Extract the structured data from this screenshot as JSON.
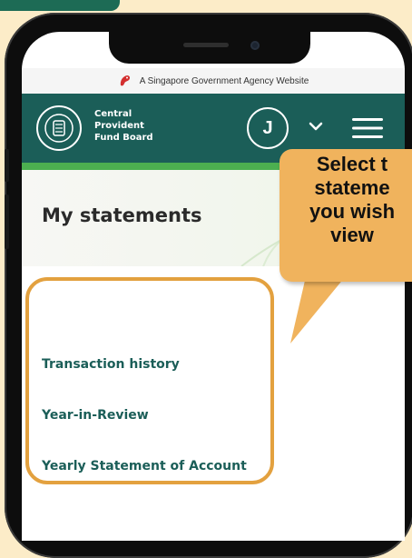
{
  "gov_banner": {
    "text": "A Singapore Government Agency Website"
  },
  "header": {
    "logo_lines": [
      "Central",
      "Provident",
      "Fund Board"
    ],
    "avatar_initial": "J",
    "icons": {
      "chevron": "chevron-down-icon",
      "menu": "hamburger-menu-icon",
      "logo": "cpf-emblem-icon",
      "gov": "merlion-icon"
    }
  },
  "page": {
    "title": "My statements",
    "links": [
      "Transaction history",
      "Year-in-Review",
      "Yearly Statement of Account"
    ]
  },
  "callout": {
    "lines": [
      "Select t",
      "stateme",
      "you wish",
      "view"
    ]
  },
  "colors": {
    "background": "#fcecc8",
    "header": "#1b5e58",
    "accent_green": "#4caf50",
    "highlight": "#e3a13f",
    "callout": "#f0b35d"
  }
}
